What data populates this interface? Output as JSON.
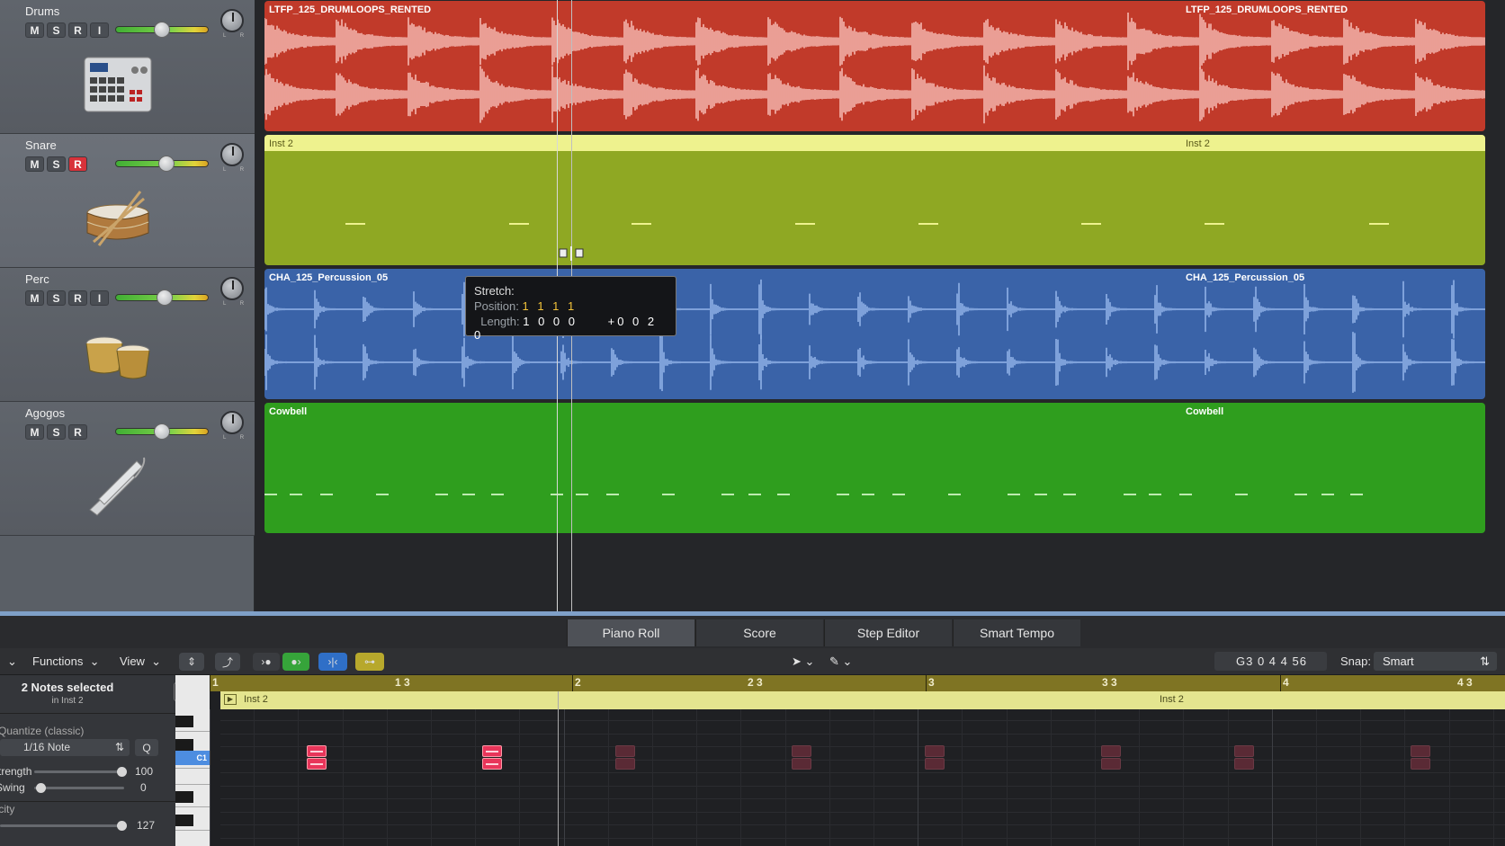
{
  "tracks": [
    {
      "name": "Drums",
      "buttons": [
        "M",
        "S",
        "R",
        "I"
      ],
      "icon": "drum-machine-icon",
      "rec_armed": false
    },
    {
      "name": "Snare",
      "buttons": [
        "M",
        "S",
        "R"
      ],
      "icon": "snare-drum-icon",
      "rec_armed": true
    },
    {
      "name": "Perc",
      "buttons": [
        "M",
        "S",
        "R",
        "I"
      ],
      "icon": "bongos-icon",
      "rec_armed": false
    },
    {
      "name": "Agogos",
      "buttons": [
        "M",
        "S",
        "R"
      ],
      "icon": "agogo-bell-icon",
      "rec_armed": false
    }
  ],
  "pan_label": "L R",
  "regions": {
    "drums": {
      "label": "LTFP_125_DRUMLOOPS_RENTED",
      "color": "#c13a2a"
    },
    "snare": {
      "label": "Inst 2",
      "color": "#8fa823"
    },
    "perc": {
      "label": "CHA_125_Percussion_05",
      "color": "#3a63a8"
    },
    "cowbell": {
      "label": "Cowbell",
      "color": "#2f9e1e"
    }
  },
  "tooltip": {
    "title": "Stretch:",
    "position_label": "Position:",
    "position_value": "1 1 1 1",
    "length_label": "Length:",
    "length_value": "1 0 0 0",
    "delta_value": "+0 0 2 0"
  },
  "editor_tabs": [
    "Piano Roll",
    "Score",
    "Step Editor",
    "Smart Tempo"
  ],
  "active_tab": "Piano Roll",
  "toolbar": {
    "functions": "Functions",
    "view": "View",
    "position": "G3  0 4 4 56",
    "snap_label": "Snap:",
    "snap_value": "Smart"
  },
  "inspector": {
    "selection_title": "2 Notes selected",
    "selection_sub": "in Inst 2",
    "quantize": "Quantize (classic)",
    "quantize_value": "1/16 Note",
    "q_button": "Q",
    "strength_label": "Strength",
    "strength_value": "100",
    "swing_label": "Swing",
    "swing_value": "0",
    "velocity_label": "Velocity",
    "velocity_value": "127"
  },
  "key_label": "C1",
  "ruler": [
    "1",
    "1 3",
    "2",
    "2 3",
    "3",
    "3 3",
    "4",
    "4 3"
  ],
  "roll_region_label": "Inst 2"
}
